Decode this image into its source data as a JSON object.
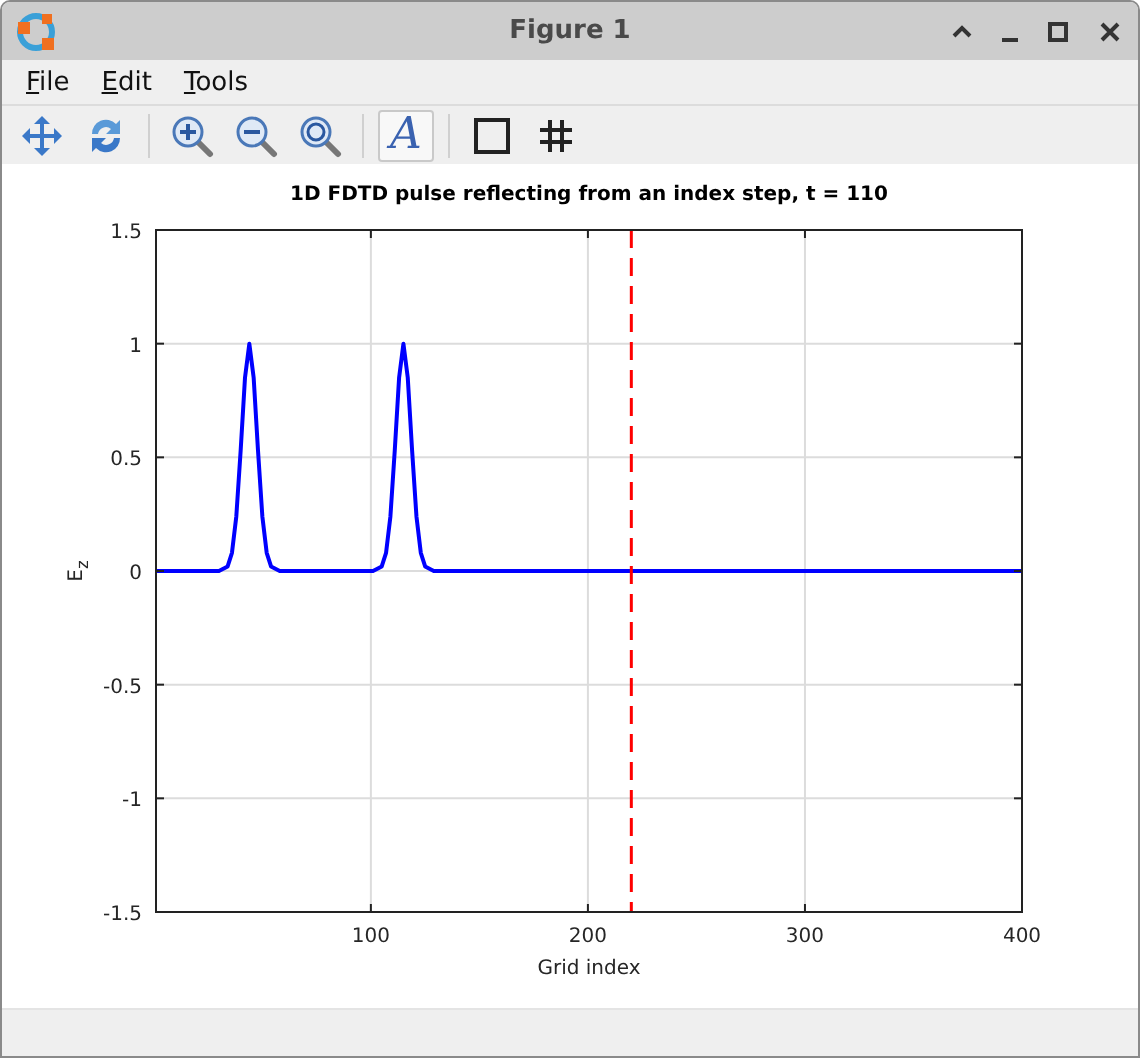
{
  "window": {
    "title": "Figure 1"
  },
  "menu": [
    {
      "label": "File"
    },
    {
      "label": "Edit"
    },
    {
      "label": "Tools"
    }
  ],
  "toolbar": [
    {
      "kind": "pan"
    },
    {
      "kind": "rotate"
    },
    {
      "kind": "separator"
    },
    {
      "kind": "zoom-in"
    },
    {
      "kind": "zoom-out"
    },
    {
      "kind": "zoom-reset"
    },
    {
      "kind": "separator"
    },
    {
      "kind": "text",
      "label": "A"
    },
    {
      "kind": "separator"
    },
    {
      "kind": "box"
    },
    {
      "kind": "grid"
    }
  ],
  "figure": {
    "chart_data": {
      "type": "line",
      "title": "1D FDTD pulse reflecting from an index step, t = 110",
      "xlabel": "Grid index",
      "ylabel": "E$_{z}$",
      "x": [
        1,
        30,
        34,
        36,
        38,
        40,
        42,
        44,
        46,
        48,
        50,
        52,
        54,
        58,
        101,
        105,
        107,
        109,
        111,
        113,
        115,
        117,
        119,
        121,
        123,
        125,
        129,
        400
      ],
      "series": [
        {
          "color": "#0000ff",
          "values": [
            0,
            0,
            0.02,
            0.08,
            0.24,
            0.53,
            0.85,
            1,
            0.85,
            0.53,
            0.24,
            0.08,
            0.02,
            0,
            0,
            0.02,
            0.08,
            0.24,
            0.53,
            0.85,
            1,
            0.85,
            0.53,
            0.24,
            0.08,
            0.02,
            0,
            0
          ]
        }
      ],
      "xlim": [
        1,
        400
      ],
      "ylim": [
        -1.5,
        1.5
      ],
      "xticks": [
        100,
        200,
        300,
        400
      ],
      "yticks": [
        {
          "value": -1.5,
          "label": "-1.5"
        },
        {
          "value": -1,
          "label": "-1"
        },
        {
          "value": -0.5,
          "label": "-0.5"
        },
        {
          "value": 0,
          "label": "0"
        },
        {
          "value": 0.5,
          "label": "0.5"
        },
        {
          "value": 1,
          "label": "1"
        },
        {
          "value": 1.5,
          "label": "1.5"
        }
      ],
      "grid": true,
      "ref_lines": [
        {
          "axis": "x",
          "value": 220,
          "color": "#ff0000"
        }
      ]
    }
  }
}
